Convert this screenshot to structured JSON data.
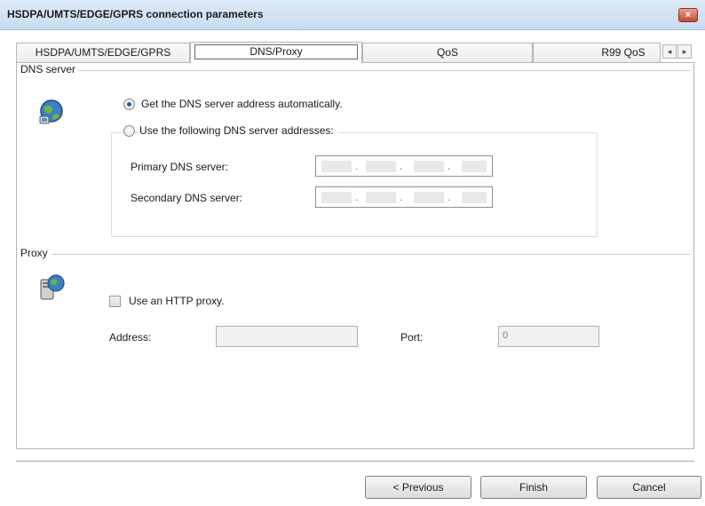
{
  "window": {
    "title": "HSDPA/UMTS/EDGE/GPRS connection parameters",
    "close_glyph": "×"
  },
  "tabs": [
    {
      "label": "HSDPA/UMTS/EDGE/GPRS"
    },
    {
      "label": "DNS/Proxy",
      "selected": true
    },
    {
      "label": "QoS"
    },
    {
      "label": "R99 QoS"
    }
  ],
  "tab_scroll": {
    "left": "◂",
    "right": "▸"
  },
  "dns": {
    "group_label": "DNS server",
    "icon": "globe-network-icon",
    "auto_label": "Get the DNS server address automatically.",
    "auto_selected": true,
    "manual_label": "Use the following DNS server addresses:",
    "primary_label": "Primary DNS server:",
    "secondary_label": "Secondary DNS server:",
    "primary_value": "",
    "secondary_value": ""
  },
  "proxy": {
    "group_label": "Proxy",
    "icon": "proxy-server-icon",
    "use_proxy_label": "Use an HTTP proxy.",
    "use_proxy_checked": false,
    "address_label": "Address:",
    "address_value": "",
    "port_label": "Port:",
    "port_value": "0"
  },
  "buttons": {
    "previous": "< Previous",
    "finish": "Finish",
    "cancel": "Cancel"
  }
}
